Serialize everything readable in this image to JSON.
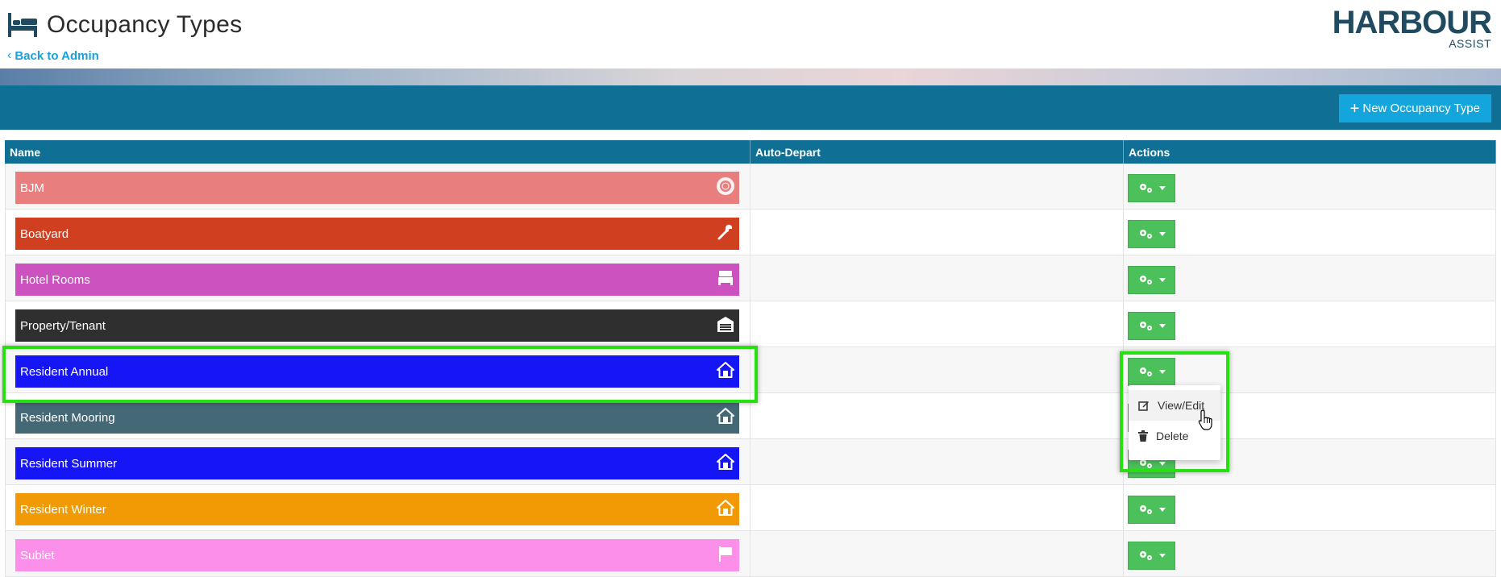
{
  "header": {
    "title": "Occupancy Types",
    "back_link": "Back to Admin",
    "logo_main": "HARBOUR",
    "logo_sub": "ASSIST"
  },
  "toolbar": {
    "new_button": "New Occupancy Type"
  },
  "table": {
    "columns": [
      "Name",
      "Auto-Depart",
      "Actions"
    ],
    "rows": [
      {
        "name": "BJM",
        "color": "#e97e7e",
        "icon": "lifebuoy-icon",
        "auto_depart": ""
      },
      {
        "name": "Boatyard",
        "color": "#d03f20",
        "icon": "wrench-icon",
        "auto_depart": ""
      },
      {
        "name": "Hotel Rooms",
        "color": "#cc52c0",
        "icon": "bed-icon",
        "auto_depart": ""
      },
      {
        "name": "Property/Tenant",
        "color": "#2f2f2f",
        "icon": "garage-icon",
        "auto_depart": ""
      },
      {
        "name": "Resident Annual",
        "color": "#1515f5",
        "icon": "house-icon",
        "auto_depart": ""
      },
      {
        "name": "Resident Mooring",
        "color": "#456877",
        "icon": "house-icon",
        "auto_depart": ""
      },
      {
        "name": "Resident Summer",
        "color": "#1515f5",
        "icon": "house-icon",
        "auto_depart": ""
      },
      {
        "name": "Resident Winter",
        "color": "#f29a05",
        "icon": "house-icon",
        "auto_depart": ""
      },
      {
        "name": "Sublet",
        "color": "#fb8fea",
        "icon": "flag-icon",
        "auto_depart": ""
      }
    ]
  },
  "dropdown": {
    "items": [
      "View/Edit",
      "Delete"
    ]
  },
  "colors": {
    "toolbar": "#0f6f95",
    "new_button": "#14a5dc",
    "action_button": "#4cc15b",
    "highlight": "#27e00f"
  }
}
